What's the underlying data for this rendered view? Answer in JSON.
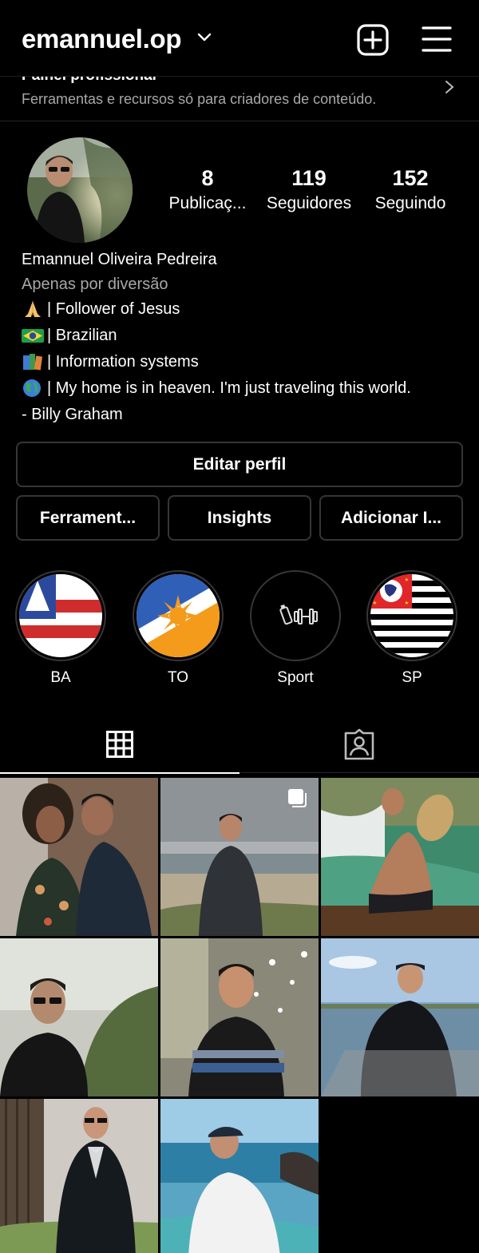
{
  "header": {
    "username": "emannuel.op"
  },
  "pro_panel": {
    "title": "Painel profissional",
    "subtitle": "Ferramentas e recursos só para criadores de conteúdo."
  },
  "stats": [
    {
      "value": "8",
      "label": "Publicaç..."
    },
    {
      "value": "119",
      "label": "Seguidores"
    },
    {
      "value": "152",
      "label": "Seguindo"
    }
  ],
  "bio": {
    "name": "Emannuel Oliveira Pedreira",
    "category": "Apenas por diversão",
    "lines": [
      {
        "icon": "praying-hands-emoji",
        "text": "| Follower of Jesus"
      },
      {
        "icon": "brazil-flag-emoji",
        "text": "| Brazilian"
      },
      {
        "icon": "books-emoji",
        "text": "| Information systems"
      },
      {
        "icon": "globe-emoji",
        "text": "| My home is in heaven. I'm just traveling this world."
      },
      {
        "icon": "",
        "text": "- Billy Graham"
      }
    ]
  },
  "buttons": {
    "edit_profile": "Editar perfil",
    "tools": "Ferrament...",
    "insights": "Insights",
    "add": "Adicionar I..."
  },
  "highlights": [
    {
      "label": "BA"
    },
    {
      "label": "TO"
    },
    {
      "label": "Sport"
    },
    {
      "label": "SP"
    }
  ],
  "colors": {
    "background": "#000000",
    "secondary_text": "#a8a8a8",
    "border": "#363636"
  },
  "icons": {
    "header_chevron": "chevron-down-icon",
    "new_post": "plus-square-icon",
    "menu": "hamburger-menu-icon",
    "panel_arrow": "chevron-right-icon",
    "grid_tab": "grid-icon",
    "tagged_tab": "tagged-person-icon",
    "multi_post": "multiple-photos-icon"
  }
}
